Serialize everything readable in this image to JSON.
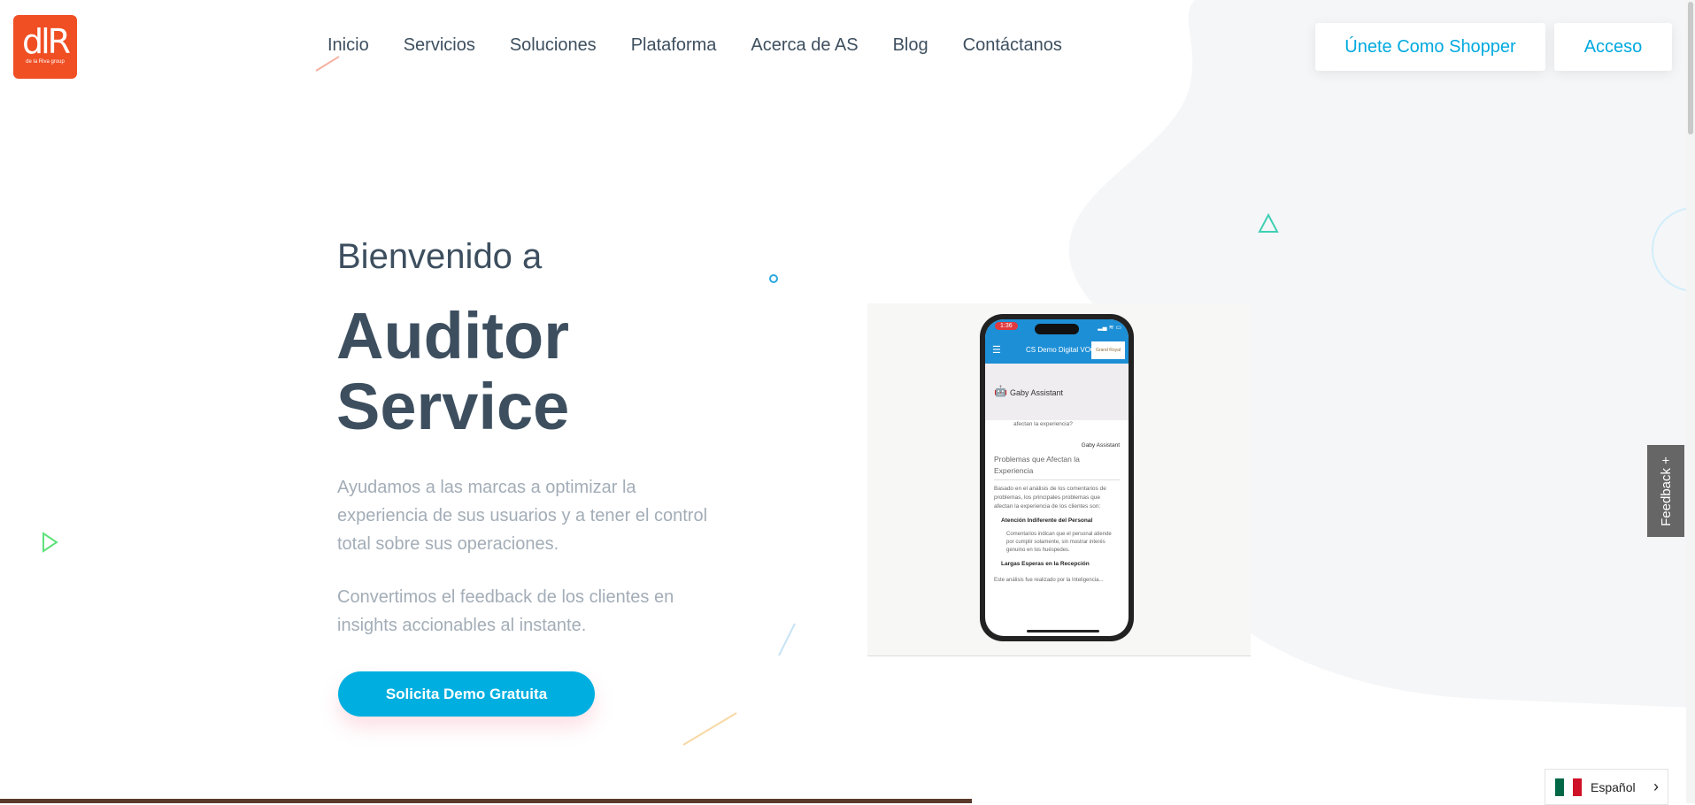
{
  "brand": {
    "logo_mark": "dlR",
    "logo_sub": "de la Riva group"
  },
  "nav": {
    "items": [
      "Inicio",
      "Servicios",
      "Soluciones",
      "Plataforma",
      "Acerca de AS",
      "Blog",
      "Contáctanos"
    ]
  },
  "header_buttons": {
    "shopper": "Únete Como Shopper",
    "login": "Acceso"
  },
  "hero": {
    "pre_title": "Bienvenido a",
    "title_line1": "Auditor",
    "title_line2": "Service",
    "paragraph1": "Ayudamos a las marcas a optimizar la experiencia de sus usuarios y  a tener el control total sobre sus operaciones.",
    "paragraph2": "Convertimos el feedback de los clientes en insights accionables al instante.",
    "cta": "Solicita Demo Gratuita"
  },
  "phone": {
    "time": "1:36",
    "status_icons": "▂▄ ≋ ▭",
    "app_title": "CS Demo Digital VOC",
    "app_logo": "Grand Royal",
    "menu_icon": "☰",
    "assistant_icon": "🤖",
    "assistant_name": "Gaby Assistant",
    "question_tail": "afectan la experiencia?",
    "reply_name": "Gaby Assistant",
    "heading": "Problemas que Afectan la Experiencia",
    "intro": "Basado en el análisis de los comentarios de problemas, los principales problemas que afectan la experiencia de los clientes son:",
    "item1_title": "Atención Indiferente del Personal",
    "item1_text": "Comentarios indican que el personal atiende por cumplir solamente, sin mostrar interés genuino en los huéspedes.",
    "item2_title": "Largas Esperas en la Recepción",
    "footer": "Este análisis fue realizado por la Inteligencia..."
  },
  "feedback_tab": "Feedback +",
  "language": {
    "label": "Español",
    "flag_colors": [
      "#006847",
      "#ffffff",
      "#ce1126"
    ]
  },
  "colors": {
    "accent": "#00afe0",
    "logo": "#f04e23",
    "text": "#3d4f5f",
    "muted": "#a3adb7"
  }
}
